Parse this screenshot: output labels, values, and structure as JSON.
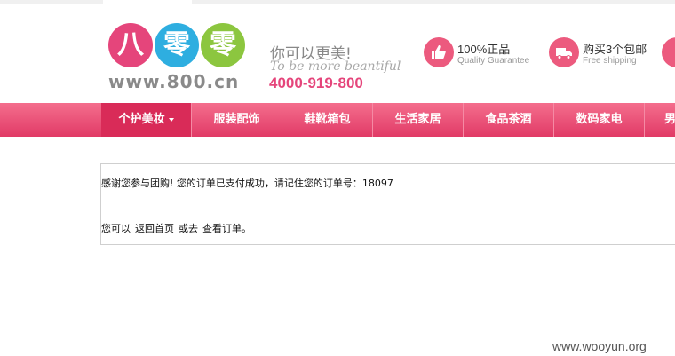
{
  "header": {
    "logo": {
      "chars": [
        "八",
        "零",
        "零"
      ],
      "url": "www.800.cn"
    },
    "slogan_cn": "你可以更美!",
    "slogan_en": "To be more beantiful",
    "hotline": "4000-919-800",
    "features": [
      {
        "icon": "thumbs-up-icon",
        "title": "100%正品",
        "subtitle": "Quality Guarantee"
      },
      {
        "icon": "truck-icon",
        "title": "购买3个包邮",
        "subtitle": "Free shipping"
      },
      {
        "icon": "return-icon",
        "title": "",
        "subtitle": ""
      }
    ]
  },
  "nav": {
    "items": [
      "个护美妆",
      "服装配饰",
      "鞋靴箱包",
      "生活家居",
      "食品茶酒",
      "数码家电",
      "男"
    ],
    "active_index": 0
  },
  "message": {
    "line1": "感谢您参与团购! 您的订单已支付成功，请记住您的订单号：18097",
    "prefix": "您可以",
    "link_home": "返回首页",
    "or": "或去",
    "link_orders": "查看订单。"
  },
  "watermark": "www.wooyun.org",
  "colors": {
    "brand_pink": "#e5457b",
    "nav_top": "#f46e8d",
    "nav_bottom": "#e13a66",
    "logo_blue": "#2eaee0",
    "logo_green": "#8cc63f"
  }
}
